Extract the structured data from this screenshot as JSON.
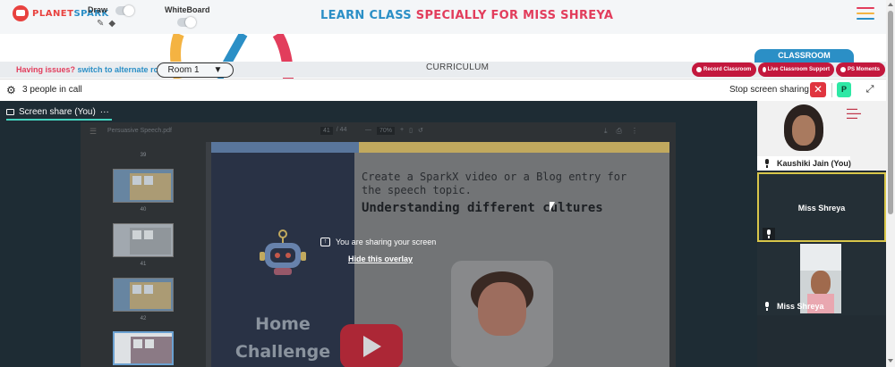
{
  "header": {
    "logo_text_1": "PLANET",
    "logo_text_2": "SPARK",
    "draw_label": "Draw",
    "whiteboard_label": "WhiteBoard",
    "title_part1": "LEARN CLASS",
    "title_part2": "SPECIALLY FOR MISS SHREYA",
    "colors": {
      "blue": "#2b8fc6",
      "red": "#e23d5c"
    },
    "hamburger_colors": [
      "#e23d5c",
      "#f4b342",
      "#2b8fc6"
    ]
  },
  "room_bar": {
    "issues_text": "Having issues?",
    "switch_text": "switch to alternate room",
    "room_value": "Room 1",
    "room_caret": "▼",
    "curriculum": "CURRICULUM",
    "classroom_tab": "CLASSROOM",
    "buttons": {
      "record": "Record Classroom",
      "support": "Live Classroom Support",
      "moments": "PS Moments"
    }
  },
  "call_bar": {
    "people": "3 people in call",
    "stop_sharing": "Stop screen sharing",
    "stop_icon": "✕",
    "p_badge": "P",
    "expand_icon": "⤢",
    "gear_icon": "⚙"
  },
  "share": {
    "tab_label": "Screen share (You)",
    "tab_more": "···",
    "pdf_name": "Persuasive Speech.pdf",
    "page_current": "41",
    "page_total": "/ 44",
    "zoom_minus": "—",
    "zoom_value": "70%",
    "zoom_plus": "+",
    "thumb_numbers": [
      "39",
      "40",
      "41",
      "42"
    ],
    "slide": {
      "home_line1": "Home",
      "home_line2": "Challenge",
      "subtitle": "Create a SparkX video or a Blog entry for the speech topic.",
      "topic": "Understanding different cultures"
    },
    "overlay_message": "You are sharing your screen",
    "overlay_link": "Hide this overlay"
  },
  "participants": [
    {
      "name": "Kaushiki Jain (You)",
      "role": "self"
    },
    {
      "name": "Miss Shreya",
      "role": "pinned"
    },
    {
      "name": "Miss Shreya",
      "role": "video"
    }
  ]
}
